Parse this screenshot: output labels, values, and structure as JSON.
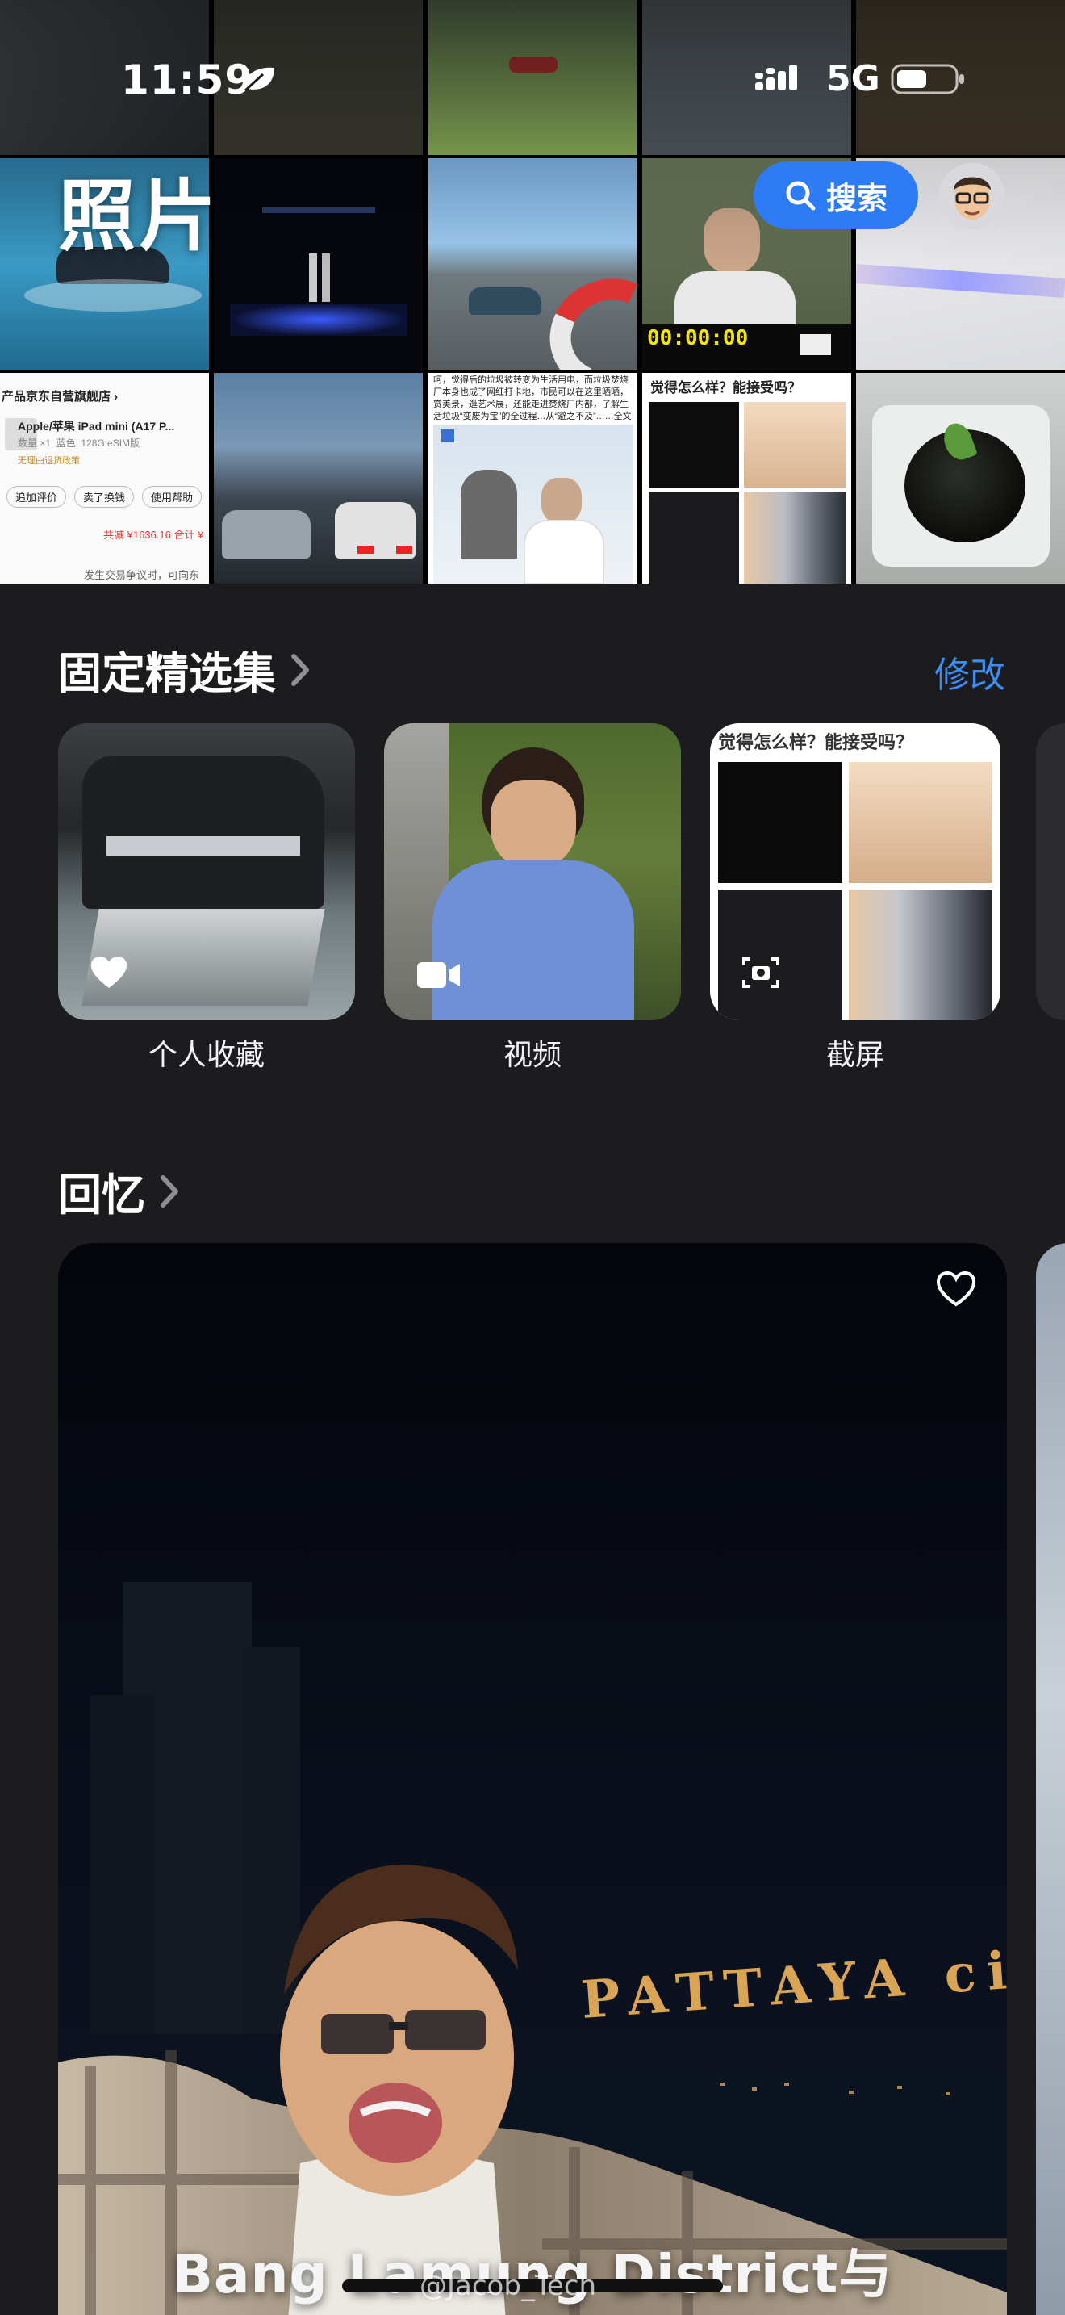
{
  "status_bar": {
    "time": "11:59",
    "network": "5G"
  },
  "header": {
    "title": "照片",
    "search_label": "搜索"
  },
  "pinned": {
    "title": "固定精选集",
    "edit_label": "修改",
    "collections": [
      {
        "label": "个人收藏",
        "icon": "heart-icon"
      },
      {
        "label": "视频",
        "icon": "video-camera-icon"
      },
      {
        "label": "截屏",
        "icon": "screenshot-icon"
      }
    ]
  },
  "memories": {
    "title": "回忆",
    "caption": "Bang Lamung District与",
    "sign_text": "PATTAYA city"
  },
  "grid_text": {
    "store_name": "产品京东自营旗舰店 ›",
    "product_name": "Apple/苹果 iPad mini (A17 P...",
    "product_spec": "数量 ×1, 蓝色, 128G eSIM版",
    "product_tag": "无理由退货政策",
    "btn_review": "追加评价",
    "btn_sell": "卖了换钱",
    "btn_help": "使用帮助",
    "price_line": "共减 ¥1636.16  合计 ¥",
    "ship_line": "发生交易争议时，可向东",
    "article_text": "呵，觉得后的垃圾被转变为生活用电，而垃圾焚烧厂本身也成了网红打卡地，市民可以在这里晒晒，赏美景，逛艺术展，还能走进焚烧厂内部，了解生活垃圾“变废为宝”的全过程…从“避之不及”……全文",
    "question_text": "觉得怎么样？能接受吗？",
    "video_timer": "00:00:00"
  },
  "watermark": "@Jacob_Tech",
  "colors": {
    "accent": "#2d7cf6",
    "edit_link": "#3b8cf5",
    "background": "#1c1c1e"
  }
}
